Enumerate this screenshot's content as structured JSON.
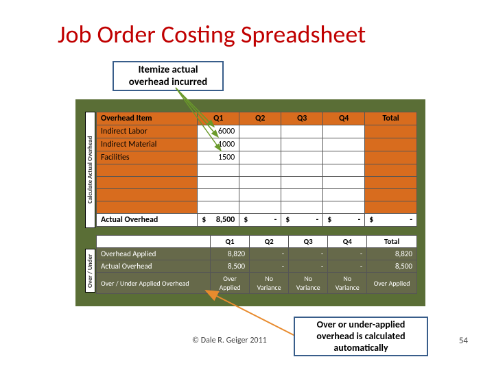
{
  "title": "Job Order Costing Spreadsheet",
  "callout_top": "Itemize actual overhead incurred",
  "callout_bottom": "Over or under-applied overhead is calculated automatically",
  "vlabel_top": "Calculate Actual Overhead",
  "vlabel_bottom": "Over / Under",
  "tbl1": {
    "headers": [
      "Overhead Item",
      "Q1",
      "Q2",
      "Q3",
      "Q4",
      "Total"
    ],
    "rows": [
      [
        "Indirect Labor",
        "6000",
        "",
        "",
        "",
        ""
      ],
      [
        "Indirect Material",
        "1000",
        "",
        "",
        "",
        ""
      ],
      [
        "Facilities",
        "1500",
        "",
        "",
        "",
        ""
      ],
      [
        "",
        "",
        "",
        "",
        "",
        ""
      ],
      [
        "",
        "",
        "",
        "",
        "",
        ""
      ],
      [
        "",
        "",
        "",
        "",
        "",
        ""
      ],
      [
        "",
        "",
        "",
        "",
        "",
        ""
      ]
    ],
    "footer_label": "Actual Overhead",
    "footer_vals": [
      "8,500",
      "-",
      "-",
      "-",
      "-"
    ]
  },
  "tbl2": {
    "headers": [
      "",
      "Q1",
      "Q2",
      "Q3",
      "Q4",
      "Total"
    ],
    "rows": [
      [
        "Overhead Applied",
        "8,820",
        "-",
        "-",
        "-",
        "8,820"
      ],
      [
        "Actual Overhead",
        "8,500",
        "-",
        "-",
        "-",
        "8,500"
      ]
    ],
    "footer": [
      "Over / Under Applied Overhead",
      "Over Applied",
      "No Variance",
      "No Variance",
      "No Variance",
      "Over Applied"
    ]
  },
  "copyright": "© Dale R. Geiger 2011",
  "page": "54"
}
